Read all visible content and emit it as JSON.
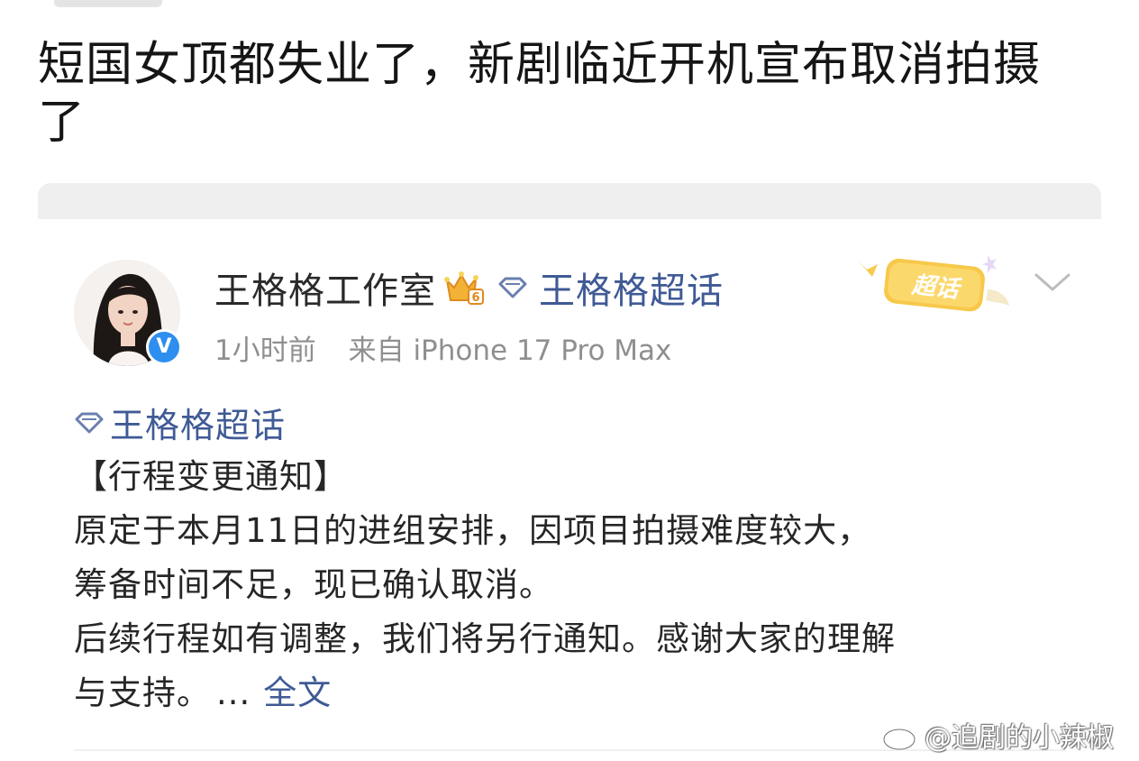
{
  "post": {
    "title": "短国女顶都失业了，新剧临近开机宣布取消拍摄了"
  },
  "weibo_card": {
    "author": {
      "name": "王格格工作室",
      "level_badge": "6",
      "verified_mark": "V",
      "topic_link": "王格格超话"
    },
    "meta": {
      "time": "1小时前",
      "source": "来自 iPhone 17 Pro Max"
    },
    "supertopic_badge": "超话",
    "content": {
      "tag": "王格格超话",
      "paragraphs": [
        "【行程变更通知】",
        "原定于本月11日的进组安排，因项目拍摄难度较大，",
        "筹备时间不足，现已确认取消。",
        "后续行程如有调整，我们将另行通知。感谢大家的理解",
        "与支持。"
      ],
      "ellipsis": "...",
      "more_label": "全文"
    }
  },
  "watermark": {
    "text": "@追剧的小辣椒"
  },
  "colors": {
    "link": "#3f5a95",
    "meta_gray": "#8f8f8f",
    "verified_blue": "#2d8ef0",
    "badge_yellow": "#f6c53c"
  },
  "icons": [
    "crown-level-icon",
    "diamond-icon",
    "chevron-down-icon",
    "weibo-logo-icon",
    "verified-badge-icon"
  ]
}
